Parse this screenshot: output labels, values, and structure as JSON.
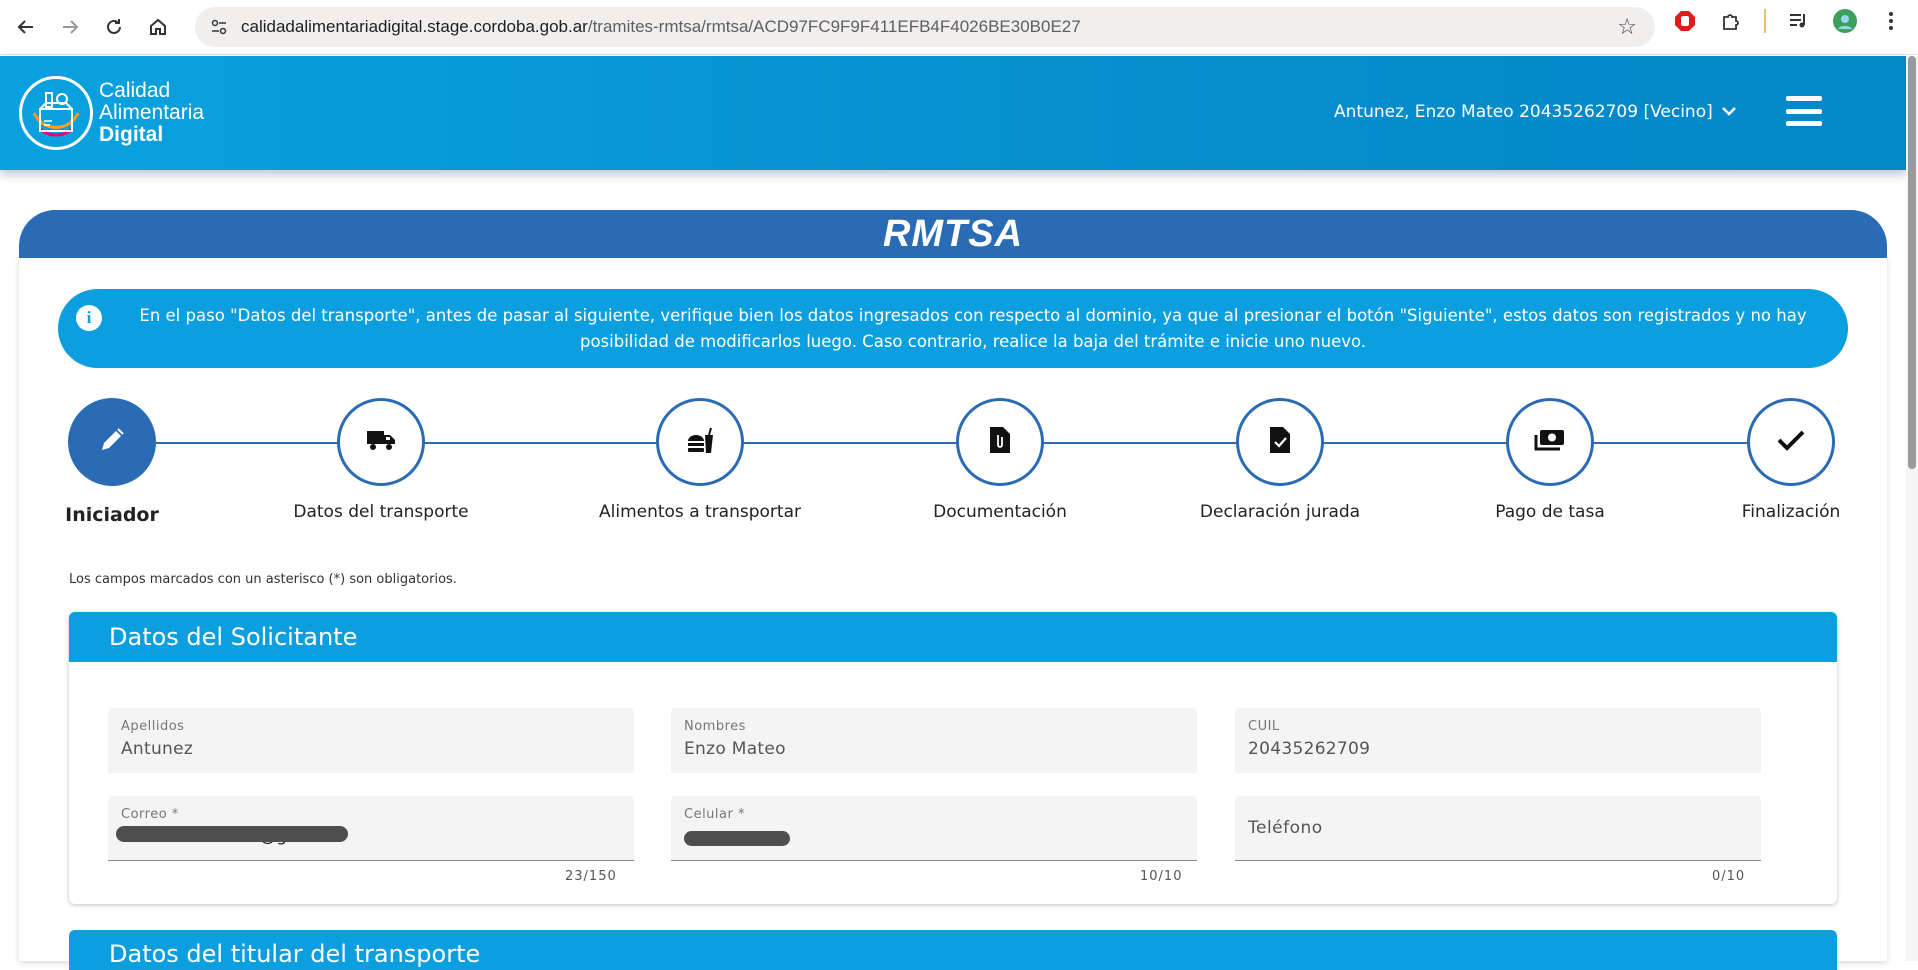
{
  "browser": {
    "url_domain": "calidadalimentariadigital.stage.cordoba.gob.ar",
    "url_path": "/tramites-rmtsa/rmtsa/ACD97FC9F9F411EFB4F4026BE30B0E27"
  },
  "header": {
    "logo_line1": "Calidad",
    "logo_line2": "Alimentaria",
    "logo_line3": "Digital",
    "user_label": "Antunez, Enzo Mateo 20435262709 [Vecino]"
  },
  "page": {
    "title": "RMTSA",
    "info_text": "En el paso \"Datos del transporte\", antes de pasar al siguiente, verifique bien los datos ingresados con respecto al dominio, ya que al presionar el botón \"Siguiente\", estos datos son registrados y no hay posibilidad de modificarlos luego. Caso contrario, realice la baja del trámite e inicie uno nuevo.",
    "required_note": "Los campos marcados con un asterisco (*) son obligatorios."
  },
  "steps": [
    {
      "label": "Iniciador",
      "icon": "pencil-icon",
      "active": true
    },
    {
      "label": "Datos del transporte",
      "icon": "truck-icon",
      "active": false
    },
    {
      "label": "Alimentos a transportar",
      "icon": "food-icon",
      "active": false
    },
    {
      "label": "Documentación",
      "icon": "file-attachment-icon",
      "active": false
    },
    {
      "label": "Declaración jurada",
      "icon": "file-check-icon",
      "active": false
    },
    {
      "label": "Pago de tasa",
      "icon": "money-icon",
      "active": false
    },
    {
      "label": "Finalización",
      "icon": "check-icon",
      "active": false
    }
  ],
  "solicitante": {
    "title": "Datos del Solicitante",
    "apellidos_label": "Apellidos",
    "apellidos_value": "Antunez",
    "nombres_label": "Nombres",
    "nombres_value": "Enzo Mateo",
    "cuil_label": "CUIL",
    "cuil_value": "20435262709",
    "correo_label": "Correo *",
    "correo_value": "mateoantunez0@gm...",
    "correo_counter": "23/150",
    "celular_label": "Celular *",
    "celular_counter": "10/10",
    "telefono_label": "Teléfono",
    "telefono_counter": "0/10"
  },
  "titular": {
    "title": "Datos del titular del transporte"
  },
  "colors": {
    "primary_blue": "#2a6bb5",
    "accent_blue": "#0b9fe0"
  }
}
